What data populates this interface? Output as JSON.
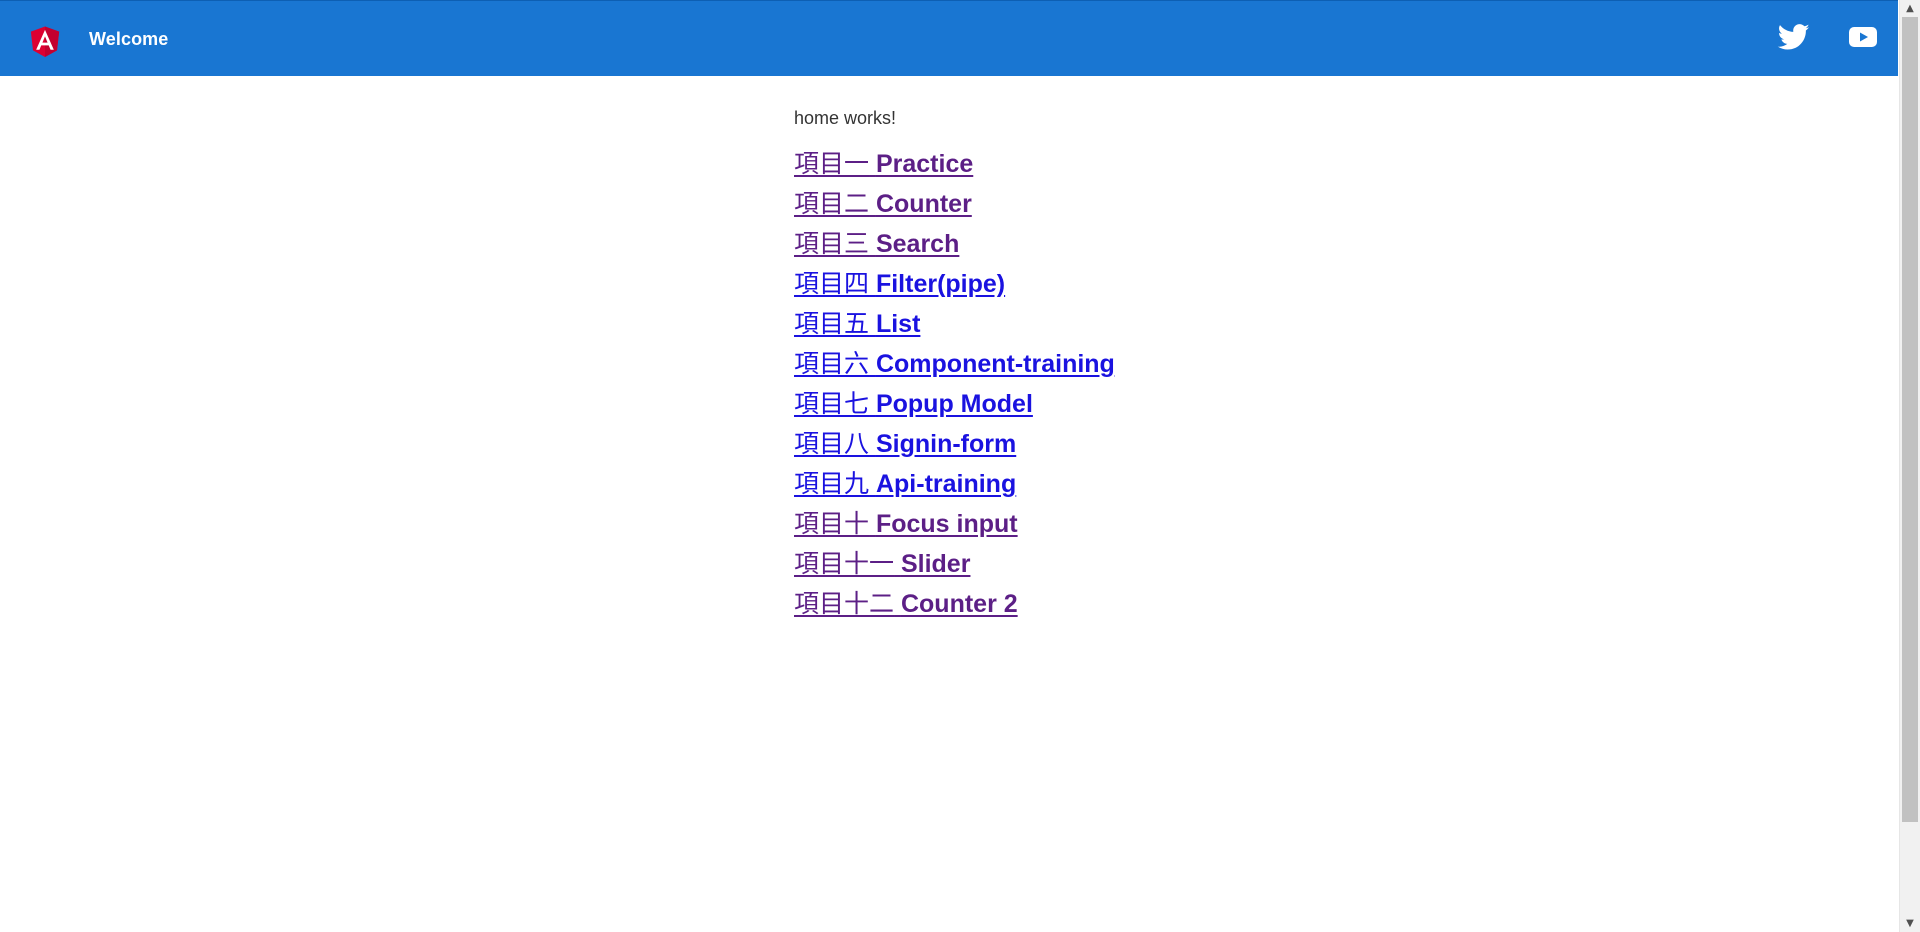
{
  "header": {
    "title": "Welcome",
    "logo_icon": "angular-logo-icon",
    "social": [
      {
        "name": "twitter-icon"
      },
      {
        "name": "youtube-icon"
      }
    ],
    "background_color": "#1976d2"
  },
  "main": {
    "intro_text": "home works!",
    "links": [
      {
        "prefix": "項目一",
        "label": "Practice",
        "visited": true
      },
      {
        "prefix": "項目二",
        "label": "Counter",
        "visited": true
      },
      {
        "prefix": "項目三",
        "label": "Search",
        "visited": true
      },
      {
        "prefix": "項目四",
        "label": "Filter(pipe)",
        "visited": false
      },
      {
        "prefix": "項目五",
        "label": "List",
        "visited": false
      },
      {
        "prefix": "項目六",
        "label": "Component-training",
        "visited": false
      },
      {
        "prefix": "項目七",
        "label": "Popup Model",
        "visited": false
      },
      {
        "prefix": "項目八",
        "label": "Signin-form",
        "visited": false
      },
      {
        "prefix": "項目九",
        "label": "Api-training",
        "visited": false
      },
      {
        "prefix": "項目十",
        "label": "Focus input",
        "visited": true
      },
      {
        "prefix": "項目十一",
        "label": "Slider",
        "visited": true
      },
      {
        "prefix": "項目十二",
        "label": "Counter 2",
        "visited": true
      }
    ],
    "visited_color": "#5c1f86",
    "unvisited_color": "#1a12e0"
  }
}
